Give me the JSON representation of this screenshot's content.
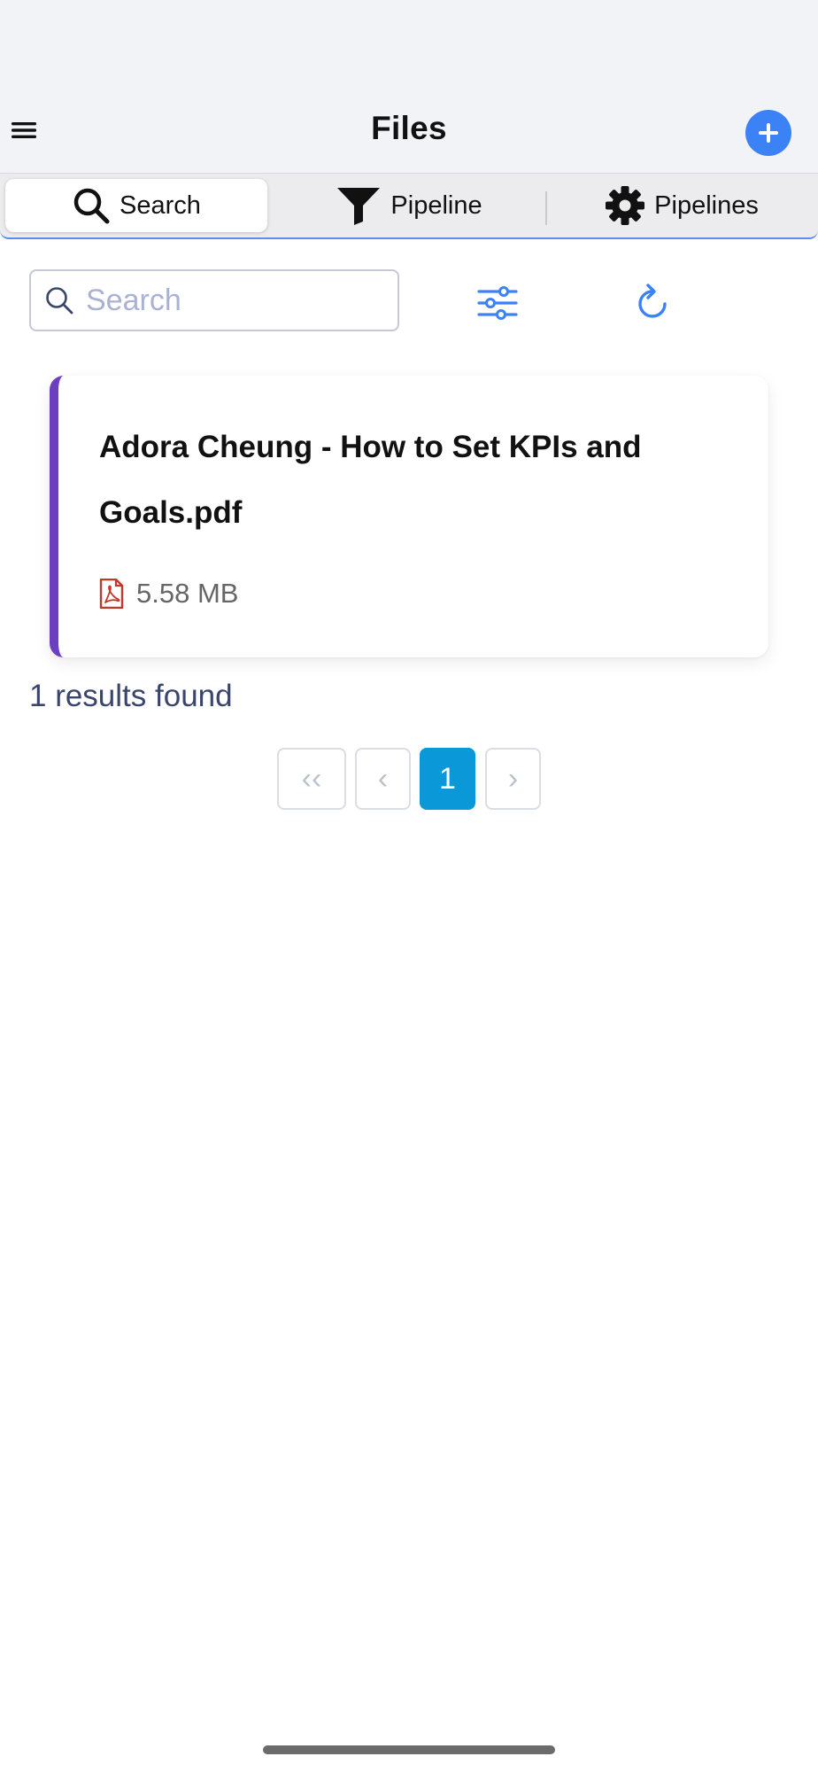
{
  "header": {
    "title": "Files",
    "menu_icon": "hamburger-menu-icon",
    "add_icon": "plus-icon"
  },
  "tabs": [
    {
      "label": "Search",
      "icon": "search-icon",
      "active": true
    },
    {
      "label": "Pipeline",
      "icon": "funnel-icon",
      "active": false
    },
    {
      "label": "Pipelines",
      "icon": "gear-icon",
      "active": false
    }
  ],
  "search": {
    "placeholder": "Search",
    "value": ""
  },
  "toolbar": {
    "filter_icon": "sliders-icon",
    "refresh_icon": "refresh-icon"
  },
  "files": [
    {
      "name": "Adora Cheung - How to Set KPIs and Goals.pdf",
      "size": "5.58 MB",
      "type_icon": "pdf-icon"
    }
  ],
  "results": {
    "text": "1 results found"
  },
  "pagination": {
    "first": "‹‹",
    "prev": "‹",
    "current": "1",
    "next": "›"
  },
  "colors": {
    "accent": "#3b82f6",
    "card_stripe": "#6b3fc0",
    "page_active": "#0a98d8",
    "pdf_icon": "#c0392b"
  }
}
